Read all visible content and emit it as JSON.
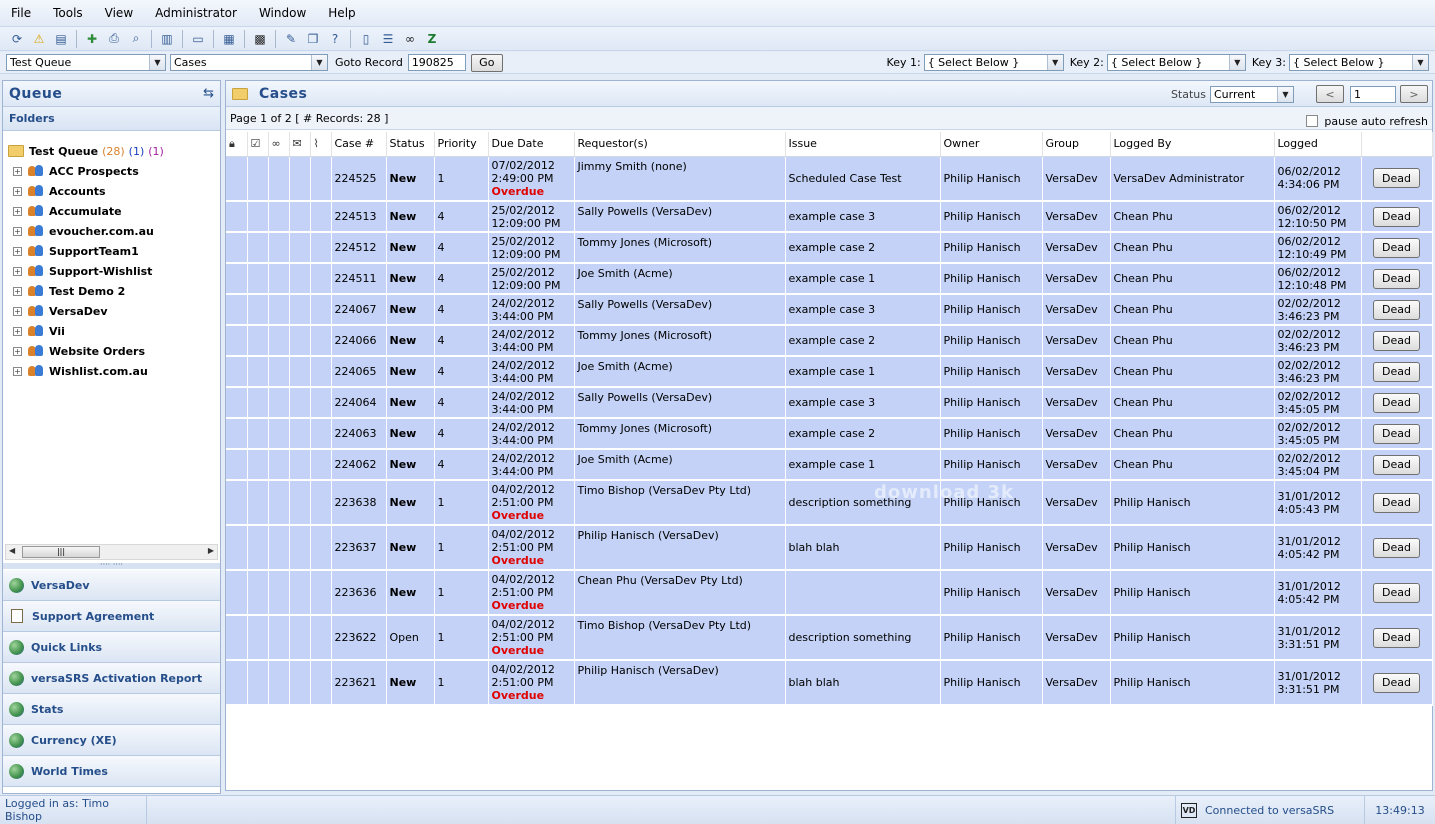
{
  "menu": [
    "File",
    "Tools",
    "View",
    "Administrator",
    "Window",
    "Help"
  ],
  "toolbar_icons": [
    "refresh-icon",
    "warning-icon",
    "document-icon",
    "add-case-icon",
    "print-icon",
    "print-preview-icon",
    "book-icon",
    "open-book-icon",
    "grid-icon",
    "film-icon",
    "edit-icon",
    "copy-icon",
    "help-icon",
    "columns-icon",
    "list-icon",
    "binoculars-icon",
    "excel-icon"
  ],
  "filter": {
    "queue": "Test Queue",
    "type": "Cases",
    "goto_label": "Goto Record",
    "goto_value": "190825",
    "go_button": "Go",
    "key1_label": "Key 1:",
    "key1_value": "{ Select Below }",
    "key2_label": "Key 2:",
    "key2_value": "{ Select Below }",
    "key3_label": "Key 3:",
    "key3_value": "{ Select Below }"
  },
  "queue": {
    "title": "Queue",
    "folders_label": "Folders",
    "root": {
      "name": "Test Queue",
      "count1": "(28)",
      "count2": "(1)",
      "count3": "(1)"
    },
    "items": [
      "ACC Prospects",
      "Accounts",
      "Accumulate",
      "evoucher.com.au",
      "SupportTeam1",
      "Support-Wishlist",
      "Test Demo 2",
      "VersaDev",
      "Vii",
      "Website Orders",
      "Wishlist.com.au"
    ]
  },
  "nav": [
    {
      "label": "VersaDev",
      "icon": "globe-icon"
    },
    {
      "label": "Support Agreement",
      "icon": "document-icon"
    },
    {
      "label": "Quick Links",
      "icon": "globe-icon"
    },
    {
      "label": "versaSRS Activation Report",
      "icon": "globe-icon"
    },
    {
      "label": "Stats",
      "icon": "globe-icon"
    },
    {
      "label": "Currency (XE)",
      "icon": "globe-icon"
    },
    {
      "label": "World Times",
      "icon": "globe-icon"
    }
  ],
  "cases": {
    "title": "Cases",
    "status_label": "Status",
    "status_value": "Current",
    "page_value": "1",
    "prev": "<",
    "next": ">",
    "page_info": "Page 1 of 2 [ # Records: 28 ]",
    "pause_label": "pause auto refresh",
    "columns": [
      "Case #",
      "Status",
      "Priority",
      "Due Date",
      "Requestor(s)",
      "Issue",
      "Owner",
      "Group",
      "Logged By",
      "Logged"
    ],
    "button_label": "Dead",
    "overdue_label": "Overdue",
    "rows": [
      {
        "id": "224525",
        "status": "New",
        "priority": "1",
        "due_date": "07/02/2012",
        "due_time": "2:49:00 PM",
        "overdue": true,
        "requestor": "Jimmy Smith (none)",
        "issue": "Scheduled Case Test",
        "owner": "Philip Hanisch",
        "group": "VersaDev",
        "logged_by": "VersaDev Administrator",
        "logged_date": "06/02/2012",
        "logged_time": "4:34:06 PM"
      },
      {
        "id": "224513",
        "status": "New",
        "priority": "4",
        "due_date": "25/02/2012",
        "due_time": "12:09:00 PM",
        "overdue": false,
        "requestor": "Sally Powells (VersaDev)",
        "issue": "example case 3",
        "owner": "Philip Hanisch",
        "group": "VersaDev",
        "logged_by": "Chean Phu",
        "logged_date": "06/02/2012",
        "logged_time": "12:10:50 PM"
      },
      {
        "id": "224512",
        "status": "New",
        "priority": "4",
        "due_date": "25/02/2012",
        "due_time": "12:09:00 PM",
        "overdue": false,
        "requestor": "Tommy Jones (Microsoft)",
        "issue": "example case 2",
        "owner": "Philip Hanisch",
        "group": "VersaDev",
        "logged_by": "Chean Phu",
        "logged_date": "06/02/2012",
        "logged_time": "12:10:49 PM"
      },
      {
        "id": "224511",
        "status": "New",
        "priority": "4",
        "due_date": "25/02/2012",
        "due_time": "12:09:00 PM",
        "overdue": false,
        "requestor": "Joe Smith (Acme)",
        "issue": "example case 1",
        "owner": "Philip Hanisch",
        "group": "VersaDev",
        "logged_by": "Chean Phu",
        "logged_date": "06/02/2012",
        "logged_time": "12:10:48 PM"
      },
      {
        "id": "224067",
        "status": "New",
        "priority": "4",
        "due_date": "24/02/2012",
        "due_time": "3:44:00 PM",
        "overdue": false,
        "requestor": "Sally Powells (VersaDev)",
        "issue": "example case 3",
        "owner": "Philip Hanisch",
        "group": "VersaDev",
        "logged_by": "Chean Phu",
        "logged_date": "02/02/2012",
        "logged_time": "3:46:23 PM"
      },
      {
        "id": "224066",
        "status": "New",
        "priority": "4",
        "due_date": "24/02/2012",
        "due_time": "3:44:00 PM",
        "overdue": false,
        "requestor": "Tommy Jones (Microsoft)",
        "issue": "example case 2",
        "owner": "Philip Hanisch",
        "group": "VersaDev",
        "logged_by": "Chean Phu",
        "logged_date": "02/02/2012",
        "logged_time": "3:46:23 PM"
      },
      {
        "id": "224065",
        "status": "New",
        "priority": "4",
        "due_date": "24/02/2012",
        "due_time": "3:44:00 PM",
        "overdue": false,
        "requestor": "Joe Smith (Acme)",
        "issue": "example case 1",
        "owner": "Philip Hanisch",
        "group": "VersaDev",
        "logged_by": "Chean Phu",
        "logged_date": "02/02/2012",
        "logged_time": "3:46:23 PM"
      },
      {
        "id": "224064",
        "status": "New",
        "priority": "4",
        "due_date": "24/02/2012",
        "due_time": "3:44:00 PM",
        "overdue": false,
        "requestor": "Sally Powells (VersaDev)",
        "issue": "example case 3",
        "owner": "Philip Hanisch",
        "group": "VersaDev",
        "logged_by": "Chean Phu",
        "logged_date": "02/02/2012",
        "logged_time": "3:45:05 PM"
      },
      {
        "id": "224063",
        "status": "New",
        "priority": "4",
        "due_date": "24/02/2012",
        "due_time": "3:44:00 PM",
        "overdue": false,
        "requestor": "Tommy Jones (Microsoft)",
        "issue": "example case 2",
        "owner": "Philip Hanisch",
        "group": "VersaDev",
        "logged_by": "Chean Phu",
        "logged_date": "02/02/2012",
        "logged_time": "3:45:05 PM"
      },
      {
        "id": "224062",
        "status": "New",
        "priority": "4",
        "due_date": "24/02/2012",
        "due_time": "3:44:00 PM",
        "overdue": false,
        "requestor": "Joe Smith (Acme)",
        "issue": "example case 1",
        "owner": "Philip Hanisch",
        "group": "VersaDev",
        "logged_by": "Chean Phu",
        "logged_date": "02/02/2012",
        "logged_time": "3:45:04 PM"
      },
      {
        "id": "223638",
        "status": "New",
        "priority": "1",
        "due_date": "04/02/2012",
        "due_time": "2:51:00 PM",
        "overdue": true,
        "requestor": "Timo Bishop (VersaDev Pty Ltd)",
        "issue": "description something",
        "owner": "Philip Hanisch",
        "group": "VersaDev",
        "logged_by": "Philip Hanisch",
        "logged_date": "31/01/2012",
        "logged_time": "4:05:43 PM"
      },
      {
        "id": "223637",
        "status": "New",
        "priority": "1",
        "due_date": "04/02/2012",
        "due_time": "2:51:00 PM",
        "overdue": true,
        "requestor": "Philip Hanisch (VersaDev)",
        "issue": "blah blah",
        "owner": "Philip Hanisch",
        "group": "VersaDev",
        "logged_by": "Philip Hanisch",
        "logged_date": "31/01/2012",
        "logged_time": "4:05:42 PM"
      },
      {
        "id": "223636",
        "status": "New",
        "priority": "1",
        "due_date": "04/02/2012",
        "due_time": "2:51:00 PM",
        "overdue": true,
        "requestor": "Chean Phu (VersaDev Pty Ltd)",
        "issue": "",
        "owner": "Philip Hanisch",
        "group": "VersaDev",
        "logged_by": "Philip Hanisch",
        "logged_date": "31/01/2012",
        "logged_time": "4:05:42 PM"
      },
      {
        "id": "223622",
        "status": "Open",
        "priority": "1",
        "due_date": "04/02/2012",
        "due_time": "2:51:00 PM",
        "overdue": true,
        "requestor": "Timo Bishop (VersaDev Pty Ltd)",
        "issue": "description something",
        "owner": "Philip Hanisch",
        "group": "VersaDev",
        "logged_by": "Philip Hanisch",
        "logged_date": "31/01/2012",
        "logged_time": "3:31:51 PM"
      },
      {
        "id": "223621",
        "status": "New",
        "priority": "1",
        "due_date": "04/02/2012",
        "due_time": "2:51:00 PM",
        "overdue": true,
        "requestor": "Philip Hanisch (VersaDev)",
        "issue": "blah blah",
        "owner": "Philip Hanisch",
        "group": "VersaDev",
        "logged_by": "Philip Hanisch",
        "logged_date": "31/01/2012",
        "logged_time": "3:31:51 PM"
      }
    ]
  },
  "watermark": "download 3k",
  "statusbar": {
    "logged_in": "Logged in as: Timo Bishop",
    "logo": "VD",
    "connection": "Connected to versaSRS",
    "time": "13:49:13"
  }
}
